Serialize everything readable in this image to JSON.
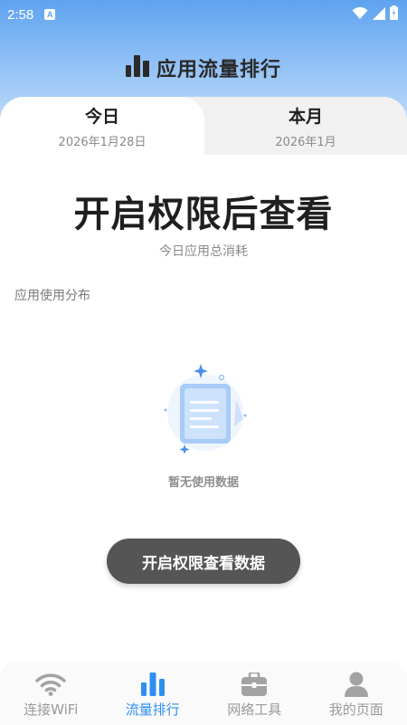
{
  "status_bar": {
    "time": "2:58",
    "notification_icon": "a-icon",
    "notification_letter": "A"
  },
  "header": {
    "icon": "bar-chart-icon",
    "title": "应用流量排行"
  },
  "tabs": [
    {
      "label": "今日",
      "sub": "2026年1月28日",
      "active": true
    },
    {
      "label": "本月",
      "sub": "2026年1月",
      "active": false
    }
  ],
  "summary": {
    "headline": "开启权限后查看",
    "caption": "今日应用总消耗"
  },
  "section": {
    "label": "应用使用分布"
  },
  "empty_state": {
    "icon": "empty-document-icon",
    "text": "暂无使用数据"
  },
  "cta": {
    "label": "开启权限查看数据"
  },
  "bottom_nav": [
    {
      "label": "连接WiFi",
      "icon": "wifi-icon",
      "active": false
    },
    {
      "label": "流量排行",
      "icon": "bar-chart-icon",
      "active": true
    },
    {
      "label": "网络工具",
      "icon": "toolbox-icon",
      "active": false
    },
    {
      "label": "我的页面",
      "icon": "person-icon",
      "active": false
    }
  ],
  "colors": {
    "accent": "#2f8ff0",
    "header_gradient_top": "#5ea3f0",
    "cta_bg": "#555555"
  }
}
